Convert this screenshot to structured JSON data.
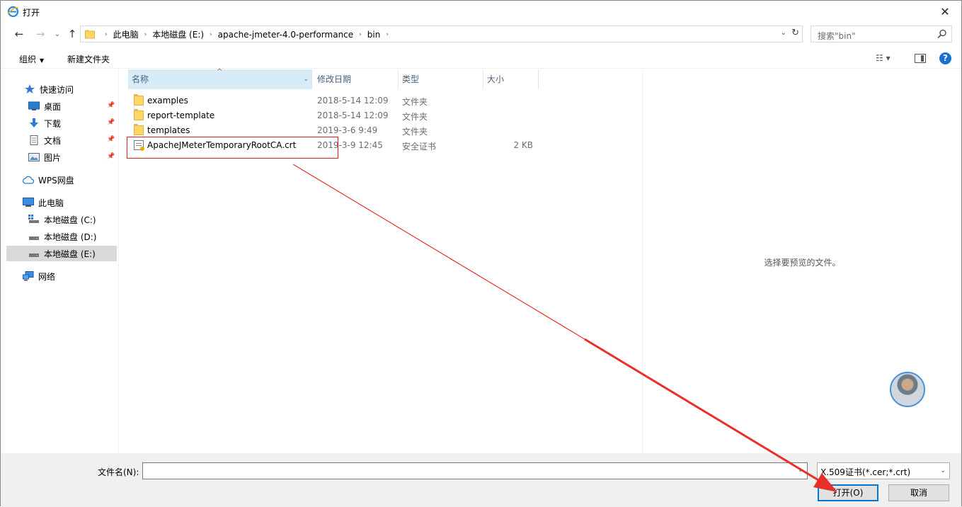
{
  "window": {
    "title": "打开",
    "app_icon": "ie-icon",
    "close_glyph": "✕"
  },
  "nav": {
    "back_glyph": "←",
    "forward_glyph": "→",
    "recent_glyph": "⌄",
    "up_glyph": "↑",
    "breadcrumbs": [
      "此电脑",
      "本地磁盘 (E:)",
      "apache-jmeter-4.0-performance",
      "bin"
    ],
    "crumb_separator": "›",
    "dropdown_glyph": "⌄",
    "refresh_glyph": "↻",
    "search_placeholder": "搜索\"bin\""
  },
  "commandbar": {
    "organize_label": "组织",
    "organize_caret": "▼",
    "new_folder_label": "新建文件夹",
    "view_glyph": "☷ ▾",
    "help_glyph": "?"
  },
  "sidebar": {
    "quick_access": "快速访问",
    "items": [
      {
        "label": "桌面",
        "pinned": true
      },
      {
        "label": "下载",
        "pinned": true
      },
      {
        "label": "文档",
        "pinned": true
      },
      {
        "label": "图片",
        "pinned": true
      }
    ],
    "wps": "WPS网盘",
    "this_pc": "此电脑",
    "drives": [
      {
        "label": "本地磁盘 (C:)"
      },
      {
        "label": "本地磁盘 (D:)"
      },
      {
        "label": "本地磁盘 (E:)",
        "selected": true
      }
    ],
    "network": "网络"
  },
  "filelist": {
    "columns": {
      "name": "名称",
      "date": "修改日期",
      "type": "类型",
      "size": "大小"
    },
    "sort_glyph": "^",
    "rows": [
      {
        "name": "examples",
        "date": "2018-5-14 12:09",
        "type": "文件夹",
        "size": "",
        "icon": "folder-icon"
      },
      {
        "name": "report-template",
        "date": "2018-5-14 12:09",
        "type": "文件夹",
        "size": "",
        "icon": "folder-icon"
      },
      {
        "name": "templates",
        "date": "2019-3-6 9:49",
        "type": "文件夹",
        "size": "",
        "icon": "folder-icon"
      },
      {
        "name": "ApacheJMeterTemporaryRootCA.crt",
        "date": "2019-3-9 12:45",
        "type": "安全证书",
        "size": "2 KB",
        "icon": "certificate-icon"
      }
    ]
  },
  "preview": {
    "text": "选择要预览的文件。"
  },
  "bottom": {
    "filename_label": "文件名(N):",
    "filename_value": "",
    "filetype_value": "X.509证书(*.cer;*.crt)",
    "open_label": "打开(O)",
    "cancel_label": "取消"
  },
  "colors": {
    "annotation": "#e8302a",
    "accent": "#0078d7",
    "header_selected": "#d9ebf9"
  }
}
